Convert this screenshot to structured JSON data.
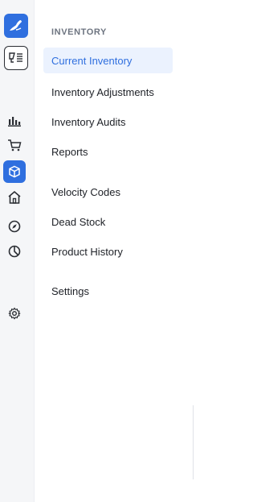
{
  "rail": {
    "items": [
      {
        "icon": "logo-icon",
        "label": ""
      },
      {
        "icon": "scanner-icon",
        "label": ""
      },
      {
        "icon": "bar-chart-icon",
        "label": ""
      },
      {
        "icon": "cart-icon",
        "label": ""
      },
      {
        "icon": "box-icon",
        "label": "",
        "active": true
      },
      {
        "icon": "home-icon",
        "label": ""
      },
      {
        "icon": "compass-icon",
        "label": ""
      },
      {
        "icon": "pie-chart-icon",
        "label": ""
      },
      {
        "icon": "gear-icon",
        "label": ""
      }
    ],
    "accent": "#2f6fdf"
  },
  "menu": {
    "section_title": "INVENTORY",
    "items": [
      {
        "label": "Current Inventory",
        "active": true
      },
      {
        "label": "Inventory Adjustments"
      },
      {
        "label": "Inventory Audits"
      },
      {
        "label": "Reports"
      },
      {
        "label": "Velocity Codes"
      },
      {
        "label": "Dead Stock"
      },
      {
        "label": "Product History"
      },
      {
        "label": "Settings"
      }
    ]
  }
}
